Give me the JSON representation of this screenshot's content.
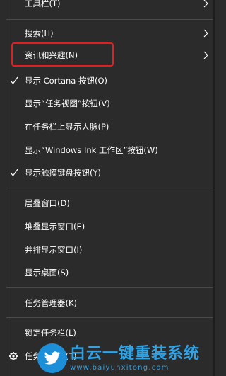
{
  "menu": {
    "items": [
      {
        "label": "工具栏(T)",
        "submenu": true,
        "checked": false
      },
      {
        "label": "搜索(H)",
        "submenu": true,
        "checked": false
      },
      {
        "label": "资讯和兴趣(N)",
        "submenu": true,
        "checked": false,
        "highlighted": true
      },
      {
        "label": "显示 Cortana 按钮(O)",
        "submenu": false,
        "checked": true
      },
      {
        "label": "显示“任务视图”按钮(V)",
        "submenu": false,
        "checked": false
      },
      {
        "label": "在任务栏上显示人脉(P)",
        "submenu": false,
        "checked": false
      },
      {
        "label": "显示“Windows Ink 工作区”按钮(W)",
        "submenu": false,
        "checked": false
      },
      {
        "label": "显示触摸键盘按钮(Y)",
        "submenu": false,
        "checked": true
      },
      {
        "label": "层叠窗口(D)",
        "submenu": false,
        "checked": false
      },
      {
        "label": "堆叠显示窗口(E)",
        "submenu": false,
        "checked": false
      },
      {
        "label": "并排显示窗口(I)",
        "submenu": false,
        "checked": false
      },
      {
        "label": "显示桌面(S)",
        "submenu": false,
        "checked": false
      },
      {
        "label": "任务管理器(K)",
        "submenu": false,
        "checked": false
      },
      {
        "label": "锁定任务栏(L)",
        "submenu": false,
        "checked": false
      },
      {
        "label": "任务栏设置(T)",
        "submenu": false,
        "checked": false,
        "icon": "gear-icon"
      }
    ]
  },
  "colors": {
    "background": "#2b2b2b",
    "text": "#ffffff",
    "separator": "#4a4a4a",
    "highlight_border": "#e02020",
    "watermark": "#2fa3e6"
  },
  "watermark": {
    "brand": "白云一键重装系统",
    "url": "www.baiyunxitong.com",
    "logo_icon": "twitter-bird-icon"
  }
}
